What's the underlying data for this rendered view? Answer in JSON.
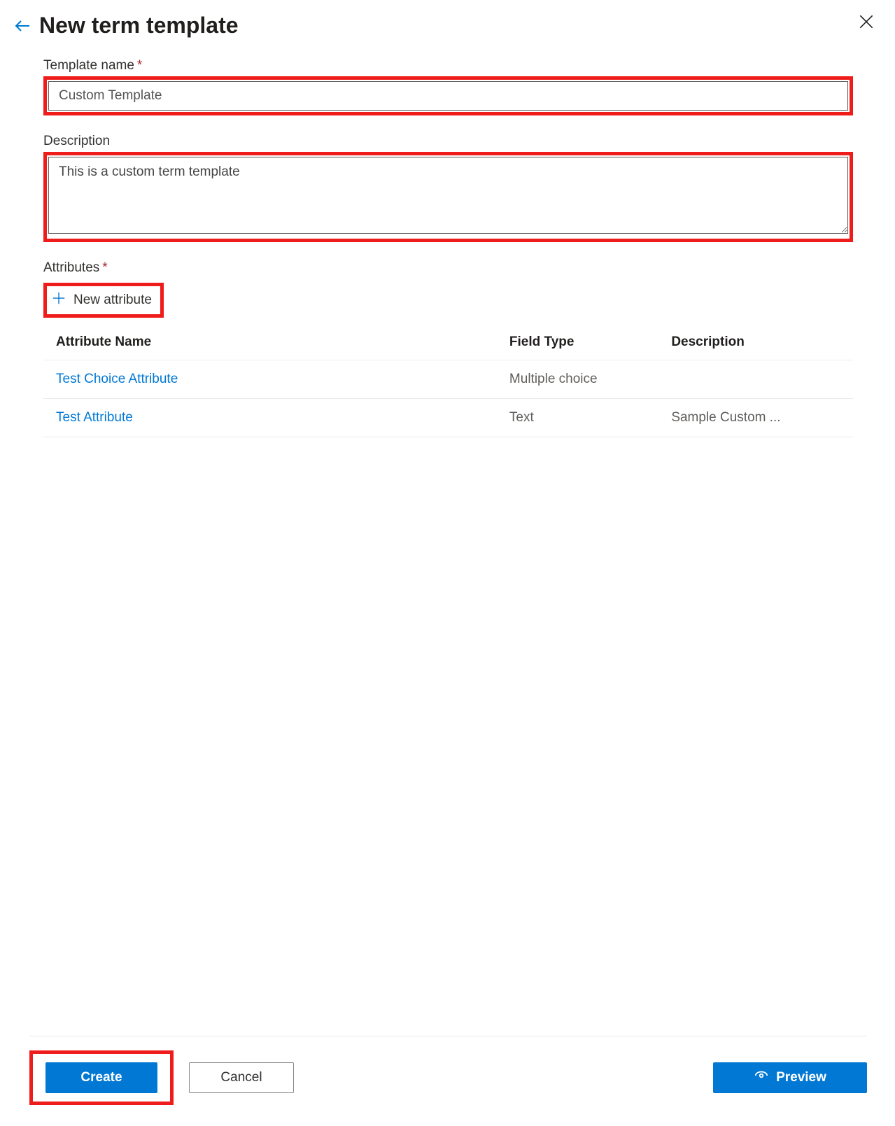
{
  "header": {
    "title": "New term template"
  },
  "form": {
    "template_name_label": "Template name",
    "template_name_value": "Custom Template",
    "description_label": "Description",
    "description_value": "This is a custom term template"
  },
  "attributes": {
    "section_label": "Attributes",
    "new_attribute_label": "New attribute",
    "columns": {
      "name": "Attribute Name",
      "type": "Field Type",
      "desc": "Description"
    },
    "rows": [
      {
        "name": "Test Choice Attribute",
        "type": "Multiple choice",
        "desc": ""
      },
      {
        "name": "Test Attribute",
        "type": "Text",
        "desc": "Sample Custom ..."
      }
    ]
  },
  "footer": {
    "create": "Create",
    "cancel": "Cancel",
    "preview": "Preview"
  }
}
